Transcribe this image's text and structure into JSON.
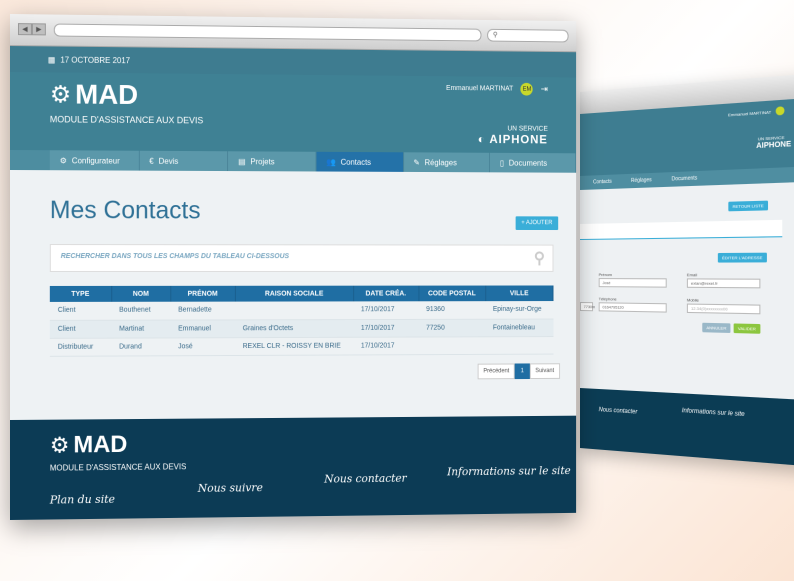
{
  "front": {
    "date": "17 OCTOBRE 2017",
    "app_name": "MAD",
    "app_subtitle": "MODULE D'ASSISTANCE AUX DEVIS",
    "user_name": "Emmanuel MARTINAT",
    "user_initials": "EM",
    "service_label": "UN SERVICE",
    "brand": "AIPHONE",
    "tabs": [
      {
        "label": "Configurateur",
        "icon": "gears-icon"
      },
      {
        "label": "Devis",
        "icon": "euro-icon"
      },
      {
        "label": "Projets",
        "icon": "folder-icon"
      },
      {
        "label": "Contacts",
        "icon": "users-icon"
      },
      {
        "label": "Réglages",
        "icon": "wrench-icon"
      },
      {
        "label": "Documents",
        "icon": "document-icon"
      }
    ],
    "active_tab": "Contacts",
    "page_title": "Mes Contacts",
    "add_button": "+ AJOUTER",
    "search_placeholder": "RECHERCHER DANS TOUS LES CHAMPS DU TABLEAU CI-DESSOUS",
    "table": {
      "headers": [
        "TYPE",
        "NOM",
        "PRÉNOM",
        "RAISON SOCIALE",
        "DATE CRÉA.",
        "CODE POSTAL",
        "VILLE"
      ],
      "rows": [
        [
          "Client",
          "Bouthenet",
          "Bernadette",
          "",
          "17/10/2017",
          "91360",
          "Epinay-sur-Orge"
        ],
        [
          "Client",
          "Martinat",
          "Emmanuel",
          "Graines d'Octets",
          "17/10/2017",
          "77250",
          "Fontainebleau"
        ],
        [
          "Distributeur",
          "Durand",
          "José",
          "REXEL CLR - ROISSY EN BRIE",
          "17/10/2017",
          "",
          ""
        ]
      ]
    },
    "pager": {
      "prev": "Précédent",
      "current": "1",
      "next": "Suivant"
    },
    "footer": {
      "app_name": "MAD",
      "app_subtitle": "MODULE D'ASSISTANCE AUX DEVIS",
      "links": [
        "Plan du site",
        "Nous suivre",
        "Nous contacter",
        "Informations sur le site"
      ]
    }
  },
  "back": {
    "user_name": "Emmanuel MARTINAT",
    "service_label": "UN SERVICE",
    "brand": "AIPHONE",
    "tabs": [
      "Contacts",
      "Réglages",
      "Documents"
    ],
    "back_button": "RETOUR LISTE",
    "address_button": "ÉDITER L'ADRESSE",
    "labels": {
      "prenom": "Prénom",
      "email": "Email",
      "telephone": "Téléphone",
      "mobile": "Mobile"
    },
    "values": {
      "prenom": "José",
      "email": "exlan@rexel.fr",
      "telephone": "0164795120",
      "mobile_placeholder": "12.34(0)xxxxxxxx00",
      "left_partial": "7730m"
    },
    "cancel_button": "ANNULER",
    "save_button": "VALIDER",
    "footer_links": [
      "Nous contacter",
      "Informations sur le site"
    ]
  }
}
